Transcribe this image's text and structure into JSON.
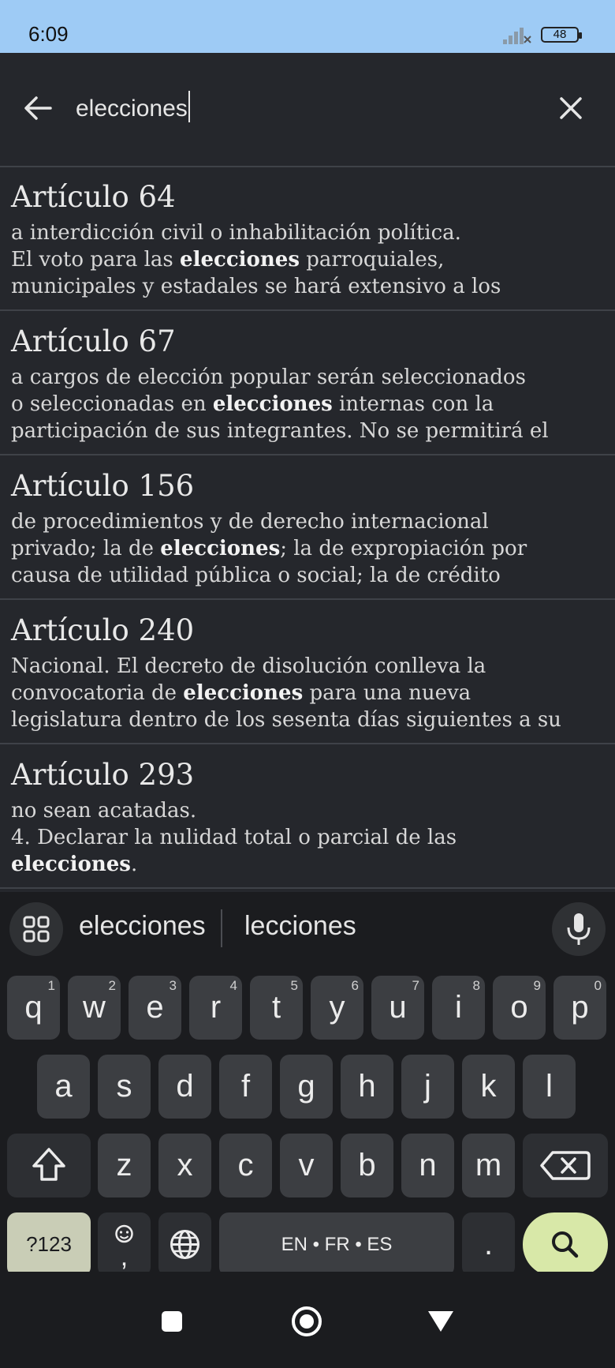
{
  "status_bar": {
    "time": "6:09",
    "battery": "48"
  },
  "search": {
    "query": "elecciones"
  },
  "results": [
    {
      "title": "Artículo 64",
      "lines": [
        {
          "before": "a interdicción civil o inhabilitación política.",
          "bold": "",
          "after": ""
        },
        {
          "before": "El voto para las ",
          "bold": "elecciones",
          "after": " parroquiales,"
        },
        {
          "before": "municipales y estadales se hará extensivo a los",
          "bold": "",
          "after": ""
        }
      ]
    },
    {
      "title": "Artículo 67",
      "lines": [
        {
          "before": "a cargos de elección popular serán seleccionados",
          "bold": "",
          "after": ""
        },
        {
          "before": "o seleccionadas en ",
          "bold": "elecciones",
          "after": " internas con la"
        },
        {
          "before": "participación de sus integrantes. No se permitirá el",
          "bold": "",
          "after": ""
        }
      ]
    },
    {
      "title": "Artículo 156",
      "lines": [
        {
          "before": "de procedimientos y de derecho internacional",
          "bold": "",
          "after": ""
        },
        {
          "before": "privado; la de ",
          "bold": "elecciones",
          "after": "; la de expropiación por"
        },
        {
          "before": "causa de utilidad pública o social; la de crédito",
          "bold": "",
          "after": ""
        }
      ]
    },
    {
      "title": "Artículo 240",
      "lines": [
        {
          "before": "Nacional. El decreto de disolución conlleva la",
          "bold": "",
          "after": ""
        },
        {
          "before": "convocatoria de ",
          "bold": "elecciones",
          "after": " para una nueva"
        },
        {
          "before": "legislatura dentro de los sesenta días siguientes a su",
          "bold": "",
          "after": ""
        }
      ]
    },
    {
      "title": "Artículo 293",
      "lines": [
        {
          "before": "no sean acatadas.",
          "bold": "",
          "after": ""
        },
        {
          "before": "4. Declarar la nulidad total o parcial de las",
          "bold": "",
          "after": ""
        },
        {
          "before": "",
          "bold": "elecciones",
          "after": "."
        }
      ]
    }
  ],
  "keyboard": {
    "suggestions": [
      "elecciones",
      "lecciones"
    ],
    "row1": [
      {
        "key": "q",
        "num": "1"
      },
      {
        "key": "w",
        "num": "2"
      },
      {
        "key": "e",
        "num": "3"
      },
      {
        "key": "r",
        "num": "4"
      },
      {
        "key": "t",
        "num": "5"
      },
      {
        "key": "y",
        "num": "6"
      },
      {
        "key": "u",
        "num": "7"
      },
      {
        "key": "i",
        "num": "8"
      },
      {
        "key": "o",
        "num": "9"
      },
      {
        "key": "p",
        "num": "0"
      }
    ],
    "row2": [
      "a",
      "s",
      "d",
      "f",
      "g",
      "h",
      "j",
      "k",
      "l"
    ],
    "row3": [
      "z",
      "x",
      "c",
      "v",
      "b",
      "n",
      "m"
    ],
    "symbols_label": "?123",
    "comma_label": ",",
    "space_label": "EN • FR • ES",
    "period_label": "."
  },
  "colors": {
    "status_bar": "#9ecbf5",
    "background": "#25272c",
    "keyboard": "#1b1c1f",
    "search_key": "#d8e8a8"
  }
}
